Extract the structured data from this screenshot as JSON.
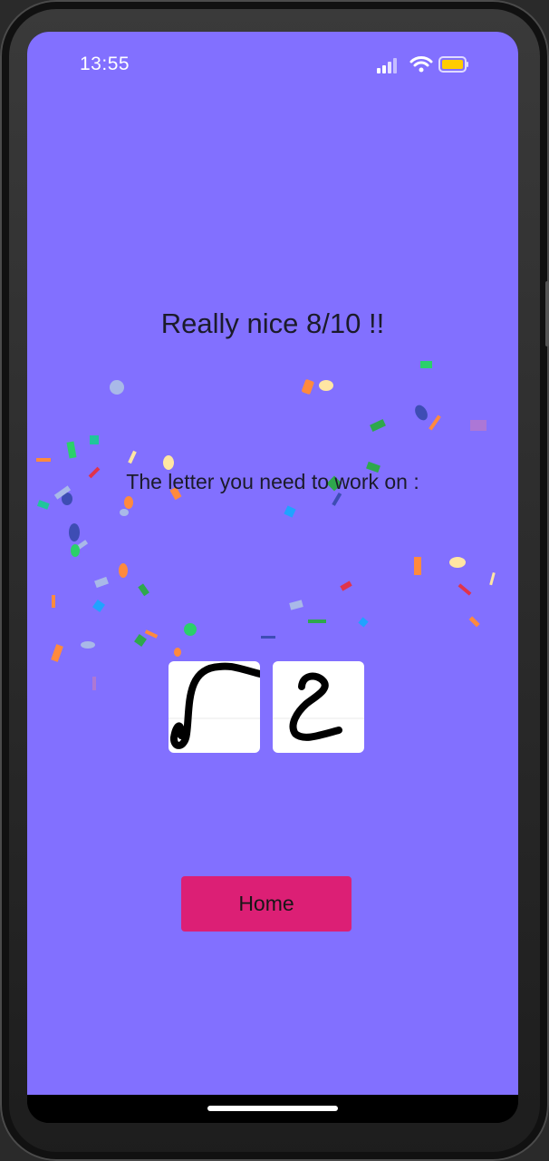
{
  "status_bar": {
    "time": "13:55",
    "signal_icon": "cellular-signal-icon",
    "wifi_icon": "wifi-icon",
    "battery_icon": "battery-icon",
    "battery_color": "#ffcc00"
  },
  "result": {
    "title": "Really nice 8/10 !!",
    "subtitle": "The letter you need to work on :"
  },
  "letters": [
    {
      "name": "letter-card-1",
      "description": "hand-drawn letter"
    },
    {
      "name": "letter-card-2",
      "description": "hand-drawn letter"
    }
  ],
  "actions": {
    "home_label": "Home"
  },
  "colors": {
    "background": "#8270ff",
    "button": "#dc1f75",
    "text": "#1b1b2a"
  }
}
